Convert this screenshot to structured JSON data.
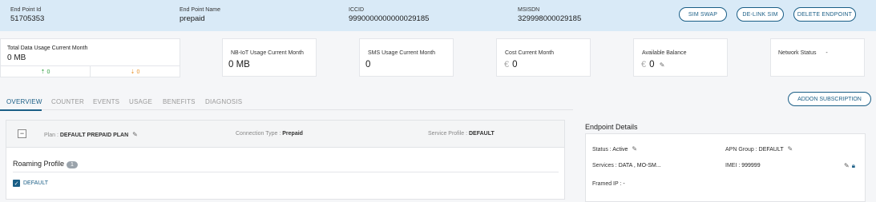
{
  "header": {
    "endpoint_id": {
      "label": "End Point Id",
      "value": "51705353"
    },
    "endpoint_name": {
      "label": "End Point Name",
      "value": "prepaid"
    },
    "iccid": {
      "label": "ICCID",
      "value": "9990000000000029185"
    },
    "msisdn": {
      "label": "MSISDN",
      "value": "329998000029185"
    },
    "buttons": {
      "sim_swap": "SIM SWAP",
      "delink_sim": "DE-LINK SIM",
      "delete_endpoint": "DELETE ENDPOINT"
    }
  },
  "stats": {
    "total_data": {
      "label": "Total Data Usage Current Month",
      "value": "0 MB",
      "upload": "0",
      "download": "0"
    },
    "nbiot": {
      "label": "NB-IoT Usage Current Month",
      "value": "0 MB"
    },
    "sms": {
      "label": "SMS Usage Current Month",
      "value": "0"
    },
    "cost": {
      "label": "Cost Current Month",
      "currency": "€",
      "value": "0"
    },
    "balance": {
      "label": "Available Balance",
      "currency": "€",
      "value": "0"
    },
    "network": {
      "label": "Network Status",
      "value": "-"
    }
  },
  "tabs": [
    "OVERVIEW",
    "COUNTER",
    "EVENTS",
    "USAGE",
    "BENEFITS",
    "DIAGNOSIS"
  ],
  "active_tab": "OVERVIEW",
  "plan_panel": {
    "collapse_glyph": "−",
    "plan_label": "Plan :",
    "plan_value": "DEFAULT PREPAID PLAN",
    "connection_label": "Connection Type :",
    "connection_value": "Prepaid",
    "service_label": "Service Profile :",
    "service_value": "DEFAULT",
    "roaming_title": "Roaming Profile",
    "roaming_count": "1",
    "roaming_items": [
      "DEFAULT"
    ]
  },
  "addon_button": "ADDON SUBSCRIPTION",
  "endpoint_details": {
    "title": "Endpoint Details",
    "status_label": "Status :",
    "status_value": "Active",
    "apn_label": "APN Group :",
    "apn_value": "DEFAULT",
    "services_label": "Services :",
    "services_value": "DATA , MO-SM...",
    "imei_label": "IMEI :",
    "imei_value": "999999",
    "framed_label": "Framed IP :",
    "framed_value": "-"
  },
  "colors": {
    "accent": "#1a5e86",
    "header_bg": "#d9eaf7",
    "upload": "#2e9e3e",
    "download": "#e8912b"
  },
  "icons": [
    "pencil-icon",
    "lock-icon",
    "upload-arrow-icon",
    "download-arrow-icon",
    "checkbox-icon"
  ]
}
